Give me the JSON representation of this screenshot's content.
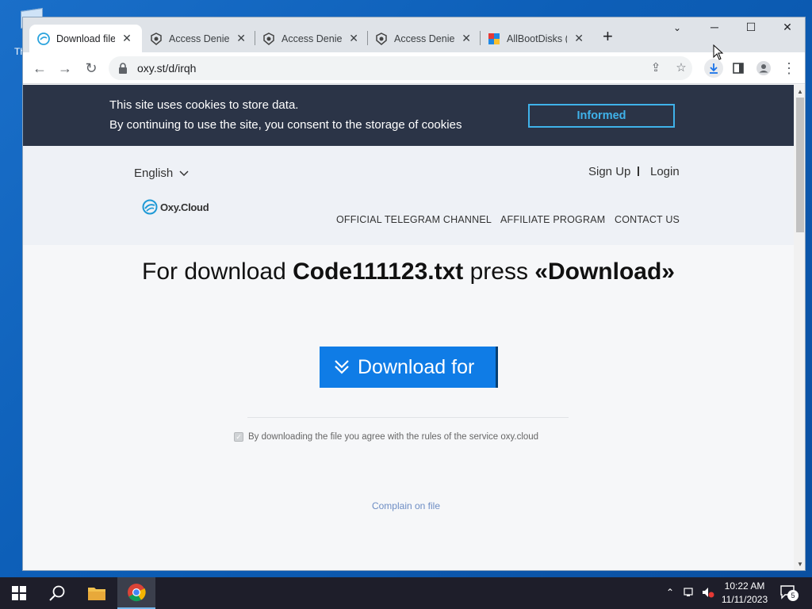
{
  "desktop": {
    "icon_label": "Th"
  },
  "browser": {
    "tabs": [
      {
        "title": "Download file",
        "icon": "oxy-cloud-favicon"
      },
      {
        "title": "Access Denied",
        "icon": "denied-favicon"
      },
      {
        "title": "Access Denied",
        "icon": "denied-favicon"
      },
      {
        "title": "Access Denied",
        "icon": "denied-favicon"
      },
      {
        "title": "AllBootDisks (C",
        "icon": "allbootdisks-favicon"
      }
    ],
    "tab_close": "✕",
    "new_tab": "+",
    "tab_search": "⌄",
    "window_controls": {
      "minimize": "─",
      "maximize": "☐",
      "close": "✕"
    },
    "url": "oxy.st/d/irqh",
    "nav": {
      "back": "←",
      "forward": "→",
      "reload": "↻"
    },
    "omnibox_actions": {
      "share": "⇪",
      "bookmark": "☆"
    },
    "menu": "⋮"
  },
  "cookie": {
    "line1": "This site uses cookies to store data.",
    "line2": "By continuing to use the site, you consent to the storage of cookies",
    "button": "Informed"
  },
  "header": {
    "language": "English",
    "signup": "Sign Up",
    "login": "Login",
    "logo": "Oxy.Cloud",
    "nav": [
      "OFFICIAL TELEGRAM CHANNEL",
      "AFFILIATE PROGRAM",
      "CONTACT US"
    ]
  },
  "main": {
    "headline_prefix": "For download ",
    "filename": "Code111123.txt",
    "headline_mid": " press ",
    "headline_action": "«Download»",
    "download_button": "Download for",
    "agreement": "By downloading the file you agree with the rules of the service oxy.cloud",
    "complain": "Complain on file"
  },
  "taskbar": {
    "time": "10:22 AM",
    "date": "11/11/2023",
    "notifications": "5"
  },
  "colors": {
    "accent": "#0f7ce6",
    "cookie_bg": "#2b3447",
    "informed": "#3fb2ea",
    "taskbar": "#1e1e2a"
  }
}
